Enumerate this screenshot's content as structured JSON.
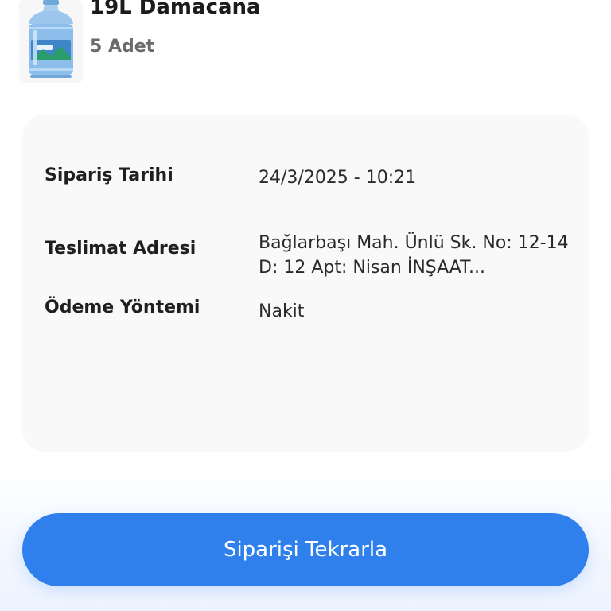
{
  "product": {
    "name": "19L Damacana",
    "quantity": "5 Adet",
    "image_icon": "water-bottle-icon"
  },
  "order_info": {
    "date_label": "Sipariş Tarihi",
    "date_value": "24/3/2025 - 10:21",
    "address_label": "Teslimat Adresi",
    "address_value": "Bağlarbaşı Mah. Ünlü Sk. No: 12-14 D: 12 Apt: Nisan İNŞAAT...",
    "payment_label": "Ödeme Yöntemi",
    "payment_value": "Nakit"
  },
  "actions": {
    "reorder_label": "Siparişi Tekrarla"
  },
  "colors": {
    "primary_button": "#2f80ed",
    "card_background": "#f9f9f9"
  }
}
